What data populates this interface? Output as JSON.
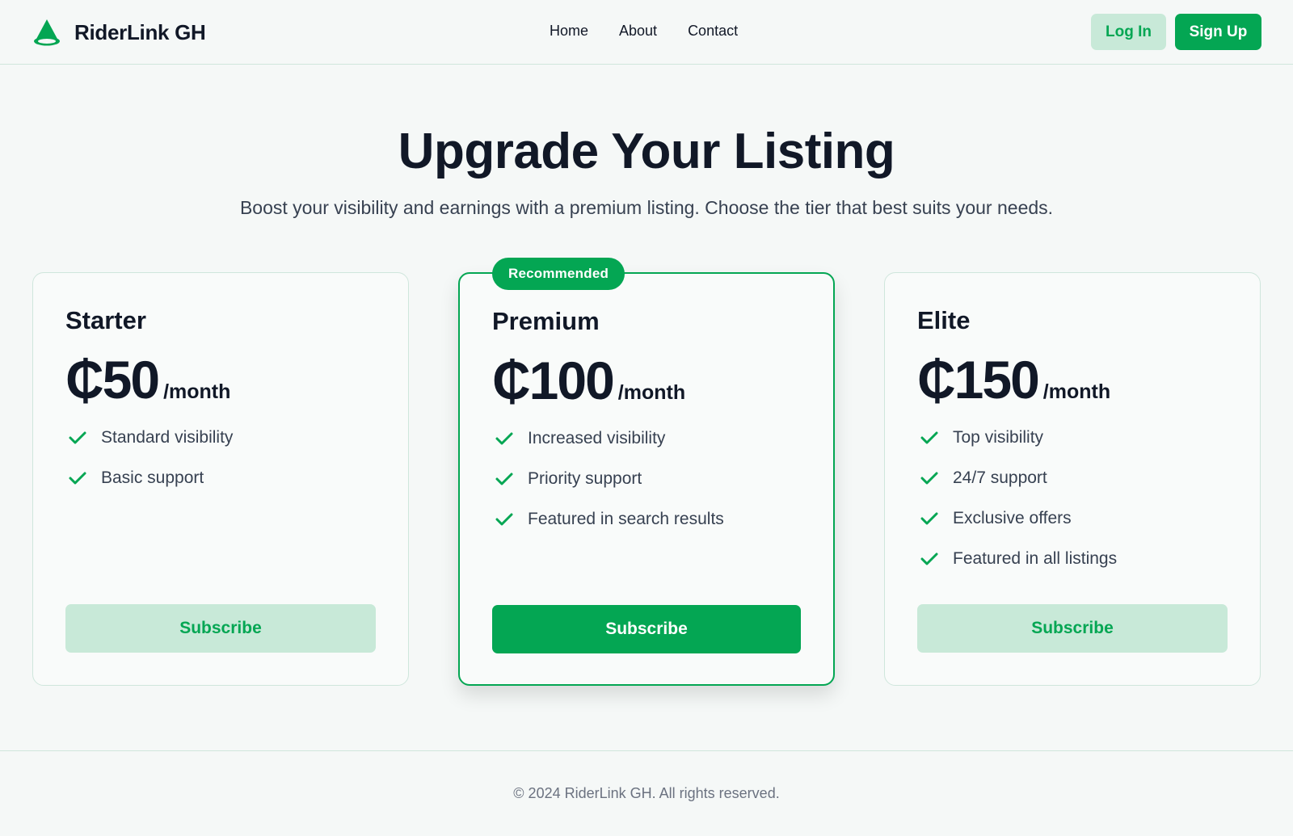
{
  "brand": {
    "name": "RiderLink GH",
    "logo_icon": "green-cone-icon",
    "accent": "#04a653"
  },
  "nav": {
    "home": "Home",
    "about": "About",
    "contact": "Contact"
  },
  "auth": {
    "login": "Log In",
    "signup": "Sign Up"
  },
  "hero": {
    "title": "Upgrade Your Listing",
    "subtitle": "Boost your visibility and earnings with a premium listing. Choose the tier that best suits your needs."
  },
  "plans": [
    {
      "name": "Starter",
      "price": "₵50",
      "period": "/month",
      "features": [
        "Standard visibility",
        "Basic support"
      ],
      "cta": "Subscribe"
    },
    {
      "badge": "Recommended",
      "name": "Premium",
      "price": "₵100",
      "period": "/month",
      "features": [
        "Increased visibility",
        "Priority support",
        "Featured in search results"
      ],
      "cta": "Subscribe"
    },
    {
      "name": "Elite",
      "price": "₵150",
      "period": "/month",
      "features": [
        "Top visibility",
        "24/7 support",
        "Exclusive offers",
        "Featured in all listings"
      ],
      "cta": "Subscribe"
    }
  ],
  "footer": {
    "copyright": "© 2024 RiderLink GH. All rights reserved."
  }
}
